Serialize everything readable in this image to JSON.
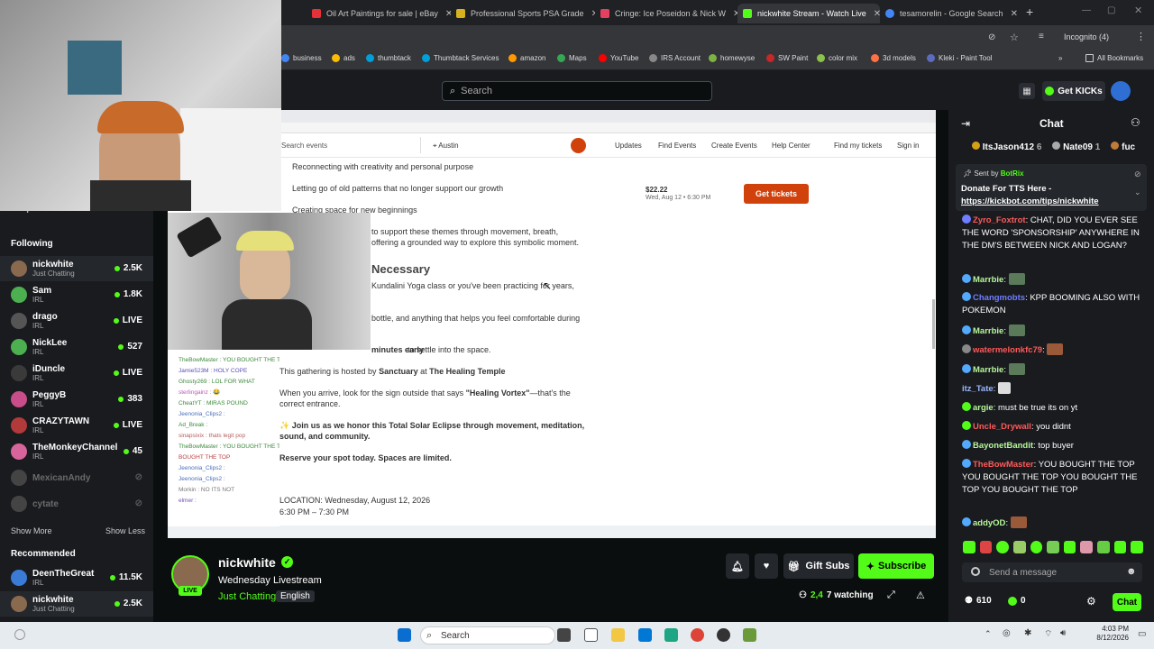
{
  "tabs": [
    {
      "label": "Oil Art Paintings for sale | eBay",
      "color": "#e53238"
    },
    {
      "label": "Professional Sports PSA Grade",
      "color": "#d7b21f"
    },
    {
      "label": "Cringe: Ice Poseidon & Nick W",
      "color": "#e4405f"
    },
    {
      "label": "nickwhite Stream - Watch Live",
      "color": "#53fc18"
    },
    {
      "label": "tesamorelin - Google Search",
      "color": "#4285f4"
    }
  ],
  "browser": {
    "incognito_label": "Incognito (4)",
    "all_bookmarks": "All Bookmarks"
  },
  "bookmarks": [
    "business",
    "ads",
    "thumbtack",
    "Thumbtack Services",
    "amazon",
    "Maps",
    "YouTube",
    "IRS Account",
    "homewyse",
    "SW Paint",
    "color mix",
    "3d models",
    "Kleki - Paint Tool"
  ],
  "header": {
    "search_placeholder": "Search",
    "get_kicks": "Get KICKs"
  },
  "sidebar": {
    "drops": "Drops",
    "following_title": "Following",
    "following": [
      {
        "name": "nickwhite",
        "category": "Just Chatting",
        "viewers": "2.5K",
        "live": true
      },
      {
        "name": "Sam",
        "category": "IRL",
        "viewers": "1.8K",
        "live": true
      },
      {
        "name": "drago",
        "category": "IRL",
        "viewers": "LIVE",
        "live": true
      },
      {
        "name": "NickLee",
        "category": "IRL",
        "viewers": "527",
        "live": true
      },
      {
        "name": "iDuncle",
        "category": "IRL",
        "viewers": "LIVE",
        "live": true
      },
      {
        "name": "PeggyB",
        "category": "IRL",
        "viewers": "383",
        "live": true
      },
      {
        "name": "CRAZYTAWN",
        "category": "IRL",
        "viewers": "LIVE",
        "live": true
      },
      {
        "name": "TheMonkeyChannel",
        "category": "IRL",
        "viewers": "45",
        "live": true
      },
      {
        "name": "MexicanAndy",
        "category": "",
        "viewers": "",
        "live": false
      },
      {
        "name": "cytate",
        "category": "",
        "viewers": "",
        "live": false
      }
    ],
    "show_more": "Show More",
    "show_less": "Show Less",
    "recommended_title": "Recommended",
    "recommended": [
      {
        "name": "DeenTheGreat",
        "category": "IRL",
        "viewers": "11.5K"
      },
      {
        "name": "nickwhite",
        "category": "Just Chatting",
        "viewers": "2.5K"
      }
    ]
  },
  "stream_page": {
    "search_events": "Search events",
    "location": "Austin",
    "nav": [
      "Updates",
      "Find Events",
      "Create Events",
      "Help Center",
      "Find my tickets",
      "Sign in"
    ],
    "price": "$22.22",
    "date": "Wed, Aug 12 • 6:30 PM",
    "get_tickets": "Get tickets",
    "lines": [
      "Reconnecting with creativity and personal purpose",
      "Letting go of old patterns that no longer support our growth",
      "Creating space for new beginnings",
      "to support these themes through movement, breath,",
      "offering a grounded way to explore this symbolic moment."
    ],
    "necessary_heading": "Necessary",
    "necessary_text": "Kundalini Yoga class or you've been practicing for years,",
    "bottle_text": "bottle, and anything that helps you feel comfortable during",
    "early_text": "minutes early",
    "settle_text": "to settle into the space.",
    "hosted_prefix": "This gathering is hosted by",
    "hosted_by": "Sanctuary",
    "hosted_at": "at",
    "temple": "The Healing Temple",
    "arrive_text": "When you arrive, look for the sign outside that says",
    "vortex": "\"Healing Vortex\"",
    "that_text": "—that's the",
    "entrance_text": "correct entrance.",
    "join_text": "Join us as we honor this Total Solar Eclipse through movement, meditation,",
    "join_text2": "sound, and community.",
    "reserve_text": "Reserve your spot today. Spaces are limited.",
    "location_text": "LOCATION: Wednesday, August 12, 2026",
    "time_text": "6:30 PM – 7:30 PM"
  },
  "overlay_chat": [
    "TheBowMaster : YOU BOUGHT THE TOP",
    "Jamie523M : HOLY COPE",
    "Ghosty269 : LOL FOR WHAT",
    "sterlingainz : 😂",
    "CheatYT : MIRAS POUND",
    "Jeenonia_Clips2 :",
    "Ad_Break : ",
    "sinapsixix : thats legit pop",
    "TheBowMaster : YOU BOUGHT THE TOP",
    "BOUGHT THE TOP",
    "Jeenonia_Clips2 :",
    "Jeenonia_Clips2 :",
    "Morkin : NO ITS NOT",
    "elmer : "
  ],
  "streamer": {
    "name": "nickwhite",
    "title": "Wednesday Livestream",
    "category": "Just Chatting",
    "language": "English",
    "live": "LIVE",
    "viewers": "2,4",
    "viewers_suffix": "7 watching",
    "gift_subs": "Gift Subs",
    "subscribe": "Subscribe"
  },
  "chat": {
    "title": "Chat",
    "top_gifters": [
      {
        "name": "ItsJason412",
        "count": "6"
      },
      {
        "name": "Nate09",
        "count": "1"
      },
      {
        "name": "fuc",
        "count": ""
      }
    ],
    "pinned_sent_by": "Sent by",
    "pinned_bot": "BotRix",
    "pinned_text": "Donate For TTS Here -",
    "pinned_link": "https://kickbot.com/tips/nickwhite",
    "messages": [
      {
        "user": "Zyro_Foxtrot",
        "color": "#ff5a5a",
        "text": "CHAT, DID YOU EVER SEE THE WORD 'SPONSORSHIP' ANYWHERE IN THE DM'S BETWEEN NICK AND LOGAN?"
      },
      {
        "user": "Marrbie",
        "color": "#b7f79a",
        "text": ""
      },
      {
        "user": "Changmobts",
        "color": "#6f7dff",
        "text": "KPP BOOMING ALSO WITH POKEMON"
      },
      {
        "user": "Marrbie",
        "color": "#b7f79a",
        "text": ""
      },
      {
        "user": "watermelonkfc79",
        "color": "#ff5a5a",
        "text": ""
      },
      {
        "user": "Marrbie",
        "color": "#b7f79a",
        "text": ""
      },
      {
        "user": "itz_Tate",
        "color": "#9ab7ff",
        "text": ""
      },
      {
        "user": "argie",
        "color": "#b7f79a",
        "text": "must be true its on yt"
      },
      {
        "user": "Uncle_Drywall",
        "color": "#ff5a5a",
        "text": "you didnt"
      },
      {
        "user": "BayonetBandit",
        "color": "#b7f79a",
        "text": "top buyer"
      },
      {
        "user": "TheBowMaster",
        "color": "#ff5a5a",
        "text": "YOU BOUGHT THE TOP YOU BOUGHT THE TOP YOU BOUGHT THE TOP YOU BOUGHT THE TOP"
      },
      {
        "user": "addyOD",
        "color": "#b7f79a",
        "text": ""
      }
    ],
    "send_placeholder": "Send a message",
    "points": "610",
    "kicks": "0",
    "send_button": "Chat"
  },
  "taskbar": {
    "search": "Search",
    "time": "4:03 PM",
    "date": "8/12/2026"
  }
}
